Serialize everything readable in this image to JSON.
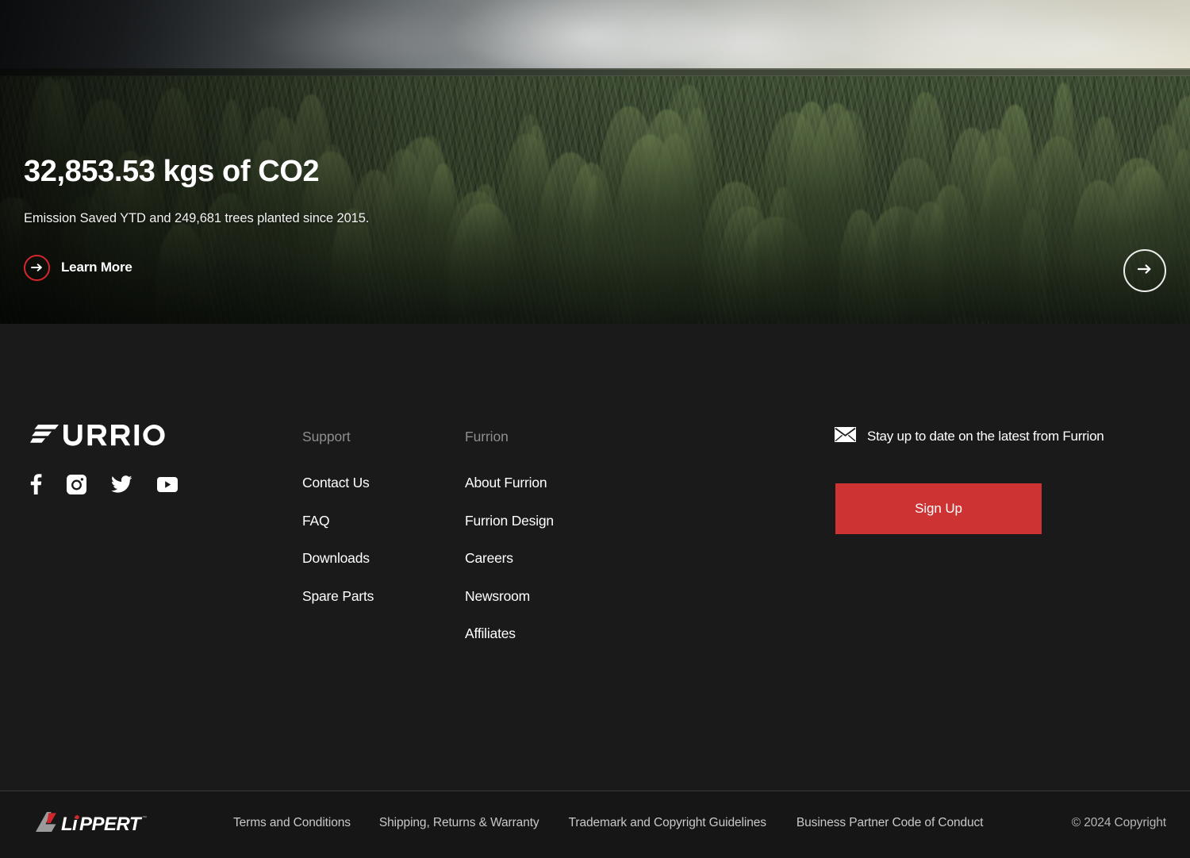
{
  "hero": {
    "title": "32,853.53 kgs of CO2",
    "subtitle": "Emission Saved YTD and 249,681 trees planted since 2015.",
    "learn_more_label": "Learn More",
    "learn_more_icon": "arrow-right-icon",
    "next_slide_icon": "arrow-right-icon",
    "accent_color": "#d8262c",
    "background": "eucalyptus-forest-photo"
  },
  "footer": {
    "brand": {
      "logo_text": "FURRION",
      "socials": [
        {
          "name": "facebook",
          "icon": "facebook-icon"
        },
        {
          "name": "instagram",
          "icon": "instagram-icon"
        },
        {
          "name": "twitter",
          "icon": "twitter-icon"
        },
        {
          "name": "youtube",
          "icon": "youtube-icon"
        }
      ]
    },
    "columns": [
      {
        "heading": "Support",
        "links": [
          "Contact Us",
          "FAQ",
          "Downloads",
          "Spare Parts"
        ]
      },
      {
        "heading": "Furrion",
        "links": [
          "About Furrion",
          "Furrion Design",
          "Careers",
          "Newsroom",
          "Affiliates"
        ]
      }
    ],
    "newsletter": {
      "icon": "mail-icon",
      "text": "Stay up to date on the latest from Furrion",
      "button_label": "Sign Up",
      "button_color": "#cd3333"
    }
  },
  "bottom_bar": {
    "partner_logo": "LiPPERT",
    "links": [
      "Terms and Conditions",
      "Shipping, Returns & Warranty",
      "Trademark and Copyright Guidelines",
      "Business Partner Code of Conduct"
    ],
    "copyright": "© 2024 Copyright"
  }
}
